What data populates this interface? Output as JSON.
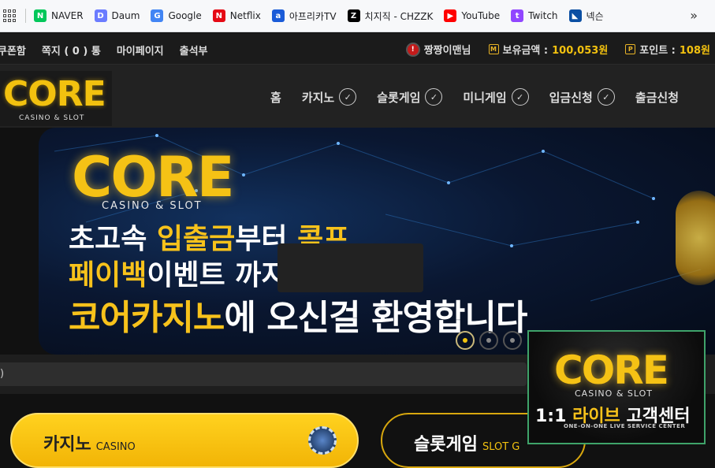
{
  "bookmarks": [
    {
      "label": "NAVER",
      "icon": "naver-icon",
      "color": "#03c75a",
      "glyph": "N"
    },
    {
      "label": "Daum",
      "icon": "daum-icon",
      "color": "#6b7cff",
      "glyph": "D"
    },
    {
      "label": "Google",
      "icon": "google-icon",
      "color": "#4285f4",
      "glyph": "G"
    },
    {
      "label": "Netflix",
      "icon": "netflix-icon",
      "color": "#e50914",
      "glyph": "N"
    },
    {
      "label": "아프리카TV",
      "icon": "afreecatv-icon",
      "color": "#1a5bd8",
      "glyph": "a"
    },
    {
      "label": "치지직 - CHZZK",
      "icon": "chzzk-icon",
      "color": "#000000",
      "glyph": "Z"
    },
    {
      "label": "YouTube",
      "icon": "youtube-icon",
      "color": "#ff0000",
      "glyph": "▶"
    },
    {
      "label": "Twitch",
      "icon": "twitch-icon",
      "color": "#9146ff",
      "glyph": "t"
    },
    {
      "label": "넥슨",
      "icon": "nexon-icon",
      "color": "#0b4fa3",
      "glyph": "◣"
    }
  ],
  "topbar": {
    "left": [
      "쿠폰함",
      "쪽지 ( 0 ) 통",
      "마이페이지",
      "출석부"
    ],
    "username": "짱짱이맨님",
    "balance_label": "보유금액 :",
    "balance_value": "100,053원",
    "points_label": "포인트 :",
    "points_value": "108원"
  },
  "logo": {
    "text": "CORE",
    "sub": "CASINO & SLOT"
  },
  "nav": [
    {
      "label": "홈",
      "has_chevron": false
    },
    {
      "label": "카지노",
      "has_chevron": true
    },
    {
      "label": "슬롯게임",
      "has_chevron": true
    },
    {
      "label": "미니게임",
      "has_chevron": true
    },
    {
      "label": "입금신청",
      "has_chevron": true
    },
    {
      "label": "출금신청",
      "has_chevron": false
    }
  ],
  "banner": {
    "logo": "CORE",
    "sub": "CASINO & SLOT",
    "line1_a": "초고속 ",
    "line1_b": "입출금",
    "line1_c": "부터 ",
    "line1_d": "콤프",
    "line2_a": "페이백",
    "line2_b": "이벤트 까지",
    "line3_a": "코어카지노",
    "line3_b": "에 오신걸 환영합니다",
    "active_slide": 1,
    "slide_count": 3
  },
  "marquee": {
    "text": ")"
  },
  "categories": {
    "casino_label": "카지노",
    "casino_sub": "CASINO",
    "slot_label": "슬롯게임",
    "slot_sub": "SLOT G"
  },
  "livebox": {
    "logo": "CORE",
    "sub": "CASINO & SLOT",
    "title_a": "1:1 ",
    "title_b": "라이브",
    "title_c": " 고객센터",
    "small": "ONE-ON-ONE LIVE SERVICE CENTER"
  }
}
